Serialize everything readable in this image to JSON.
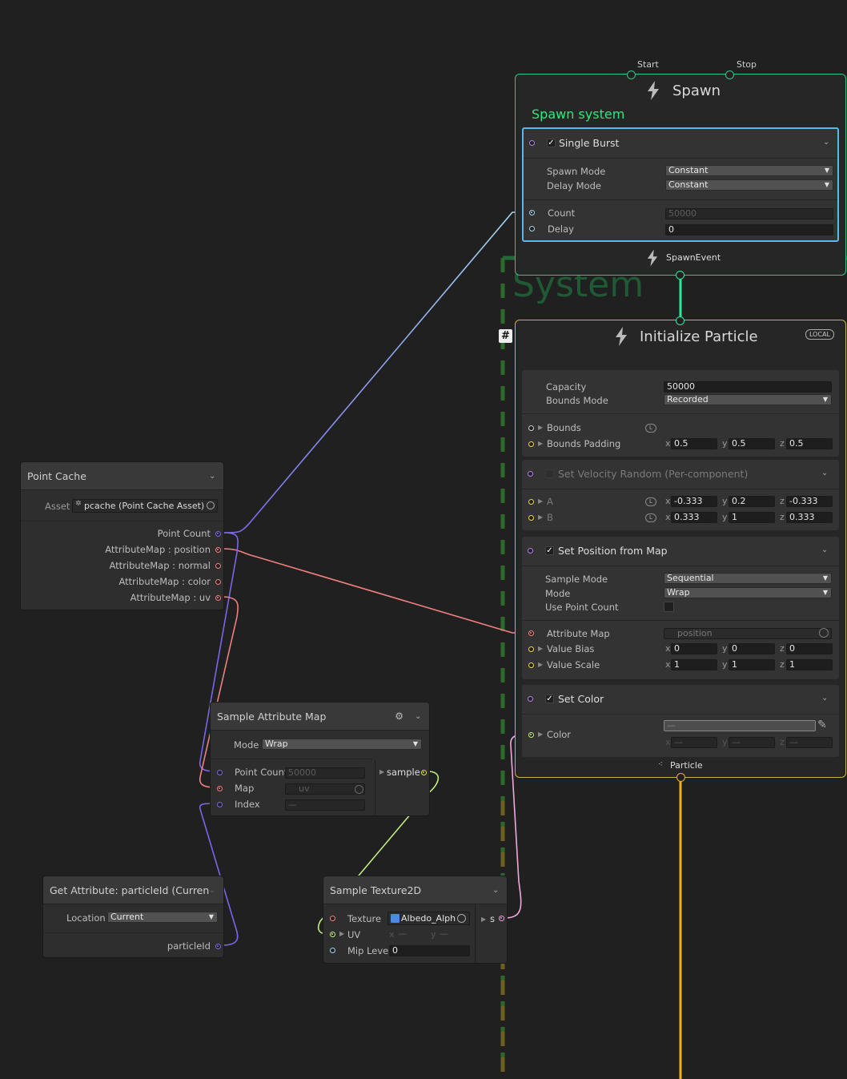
{
  "colors": {
    "background": "#202020",
    "spawn_context": "#2fc68a",
    "init_context": "#c9b340",
    "system_dashes_green": "#1f6a38",
    "system_dashes_yellow": "#7a6a1a",
    "selection_blue": "#5ab8f0",
    "wire_uint": "#7a66e8",
    "wire_vector3": "#f08080",
    "wire_vector2": "#c0f080",
    "wire_color": "#f0a8d8",
    "wire_float": "#a0d8f0",
    "flow_spawn": "#2ee89a",
    "flow_particle": "#f0b020"
  },
  "system": {
    "label": "System"
  },
  "spawn": {
    "start_label": "Start",
    "stop_label": "Stop",
    "icon": "lightning-icon",
    "title": "Spawn",
    "subtitle": "Spawn system",
    "output_label": "SpawnEvent",
    "burst": {
      "title": "Single Burst",
      "checked": true,
      "spawn_mode_label": "Spawn Mode",
      "spawn_mode_value": "Constant",
      "delay_mode_label": "Delay Mode",
      "delay_mode_value": "Constant",
      "count_label": "Count",
      "count_value": "50000",
      "delay_label": "Delay",
      "delay_value": "0"
    }
  },
  "init": {
    "title": "Initialize Particle",
    "badge": "LOCAL",
    "hash": "#",
    "capacity_label": "Capacity",
    "capacity_value": "50000",
    "bounds_mode_label": "Bounds Mode",
    "bounds_mode_value": "Recorded",
    "bounds_label": "Bounds",
    "bounds_padding_label": "Bounds Padding",
    "bounds_padding": {
      "x": "0.5",
      "y": "0.5",
      "z": "0.5"
    },
    "velocity": {
      "title": "Set Velocity Random (Per-component)",
      "checked": false,
      "a_label": "A",
      "a": {
        "x": "-0.333",
        "y": "0.2",
        "z": "-0.333"
      },
      "b_label": "B",
      "b": {
        "x": "0.333",
        "y": "1",
        "z": "0.333"
      }
    },
    "position_map": {
      "title": "Set Position from Map",
      "checked": true,
      "sample_mode_label": "Sample Mode",
      "sample_mode_value": "Sequential",
      "mode_label": "Mode",
      "mode_value": "Wrap",
      "use_point_count_label": "Use Point Count",
      "attribute_map_label": "Attribute Map",
      "attribute_map_value": "position",
      "value_bias_label": "Value Bias",
      "value_bias": {
        "x": "0",
        "y": "0",
        "z": "0"
      },
      "value_scale_label": "Value Scale",
      "value_scale": {
        "x": "1",
        "y": "1",
        "z": "1"
      }
    },
    "color": {
      "title": "Set Color",
      "checked": true,
      "color_label": "Color",
      "dash": "—"
    },
    "output_label": "Particle"
  },
  "point_cache": {
    "title": "Point Cache",
    "asset_label": "Asset",
    "asset_value": "pcache (Point Cache Asset)",
    "outputs": [
      "Point Count",
      "AttributeMap : position",
      "AttributeMap : normal",
      "AttributeMap : color",
      "AttributeMap : uv"
    ]
  },
  "sample_attr": {
    "title": "Sample Attribute Map",
    "mode_label": "Mode",
    "mode_value": "Wrap",
    "point_count_label": "Point Count",
    "point_count_value": "50000",
    "map_label": "Map",
    "map_value": "uv",
    "index_label": "Index",
    "index_value": "—",
    "output_label": "sample"
  },
  "get_attr": {
    "title": "Get Attribute: particleId (Current)",
    "location_label": "Location",
    "location_value": "Current",
    "output_label": "particleId"
  },
  "sample_tex": {
    "title": "Sample Texture2D",
    "texture_label": "Texture",
    "texture_value": "Albedo_Alph",
    "uv_label": "UV",
    "mip_label": "Mip Level",
    "mip_value": "0",
    "output_label": "s",
    "dash": "—"
  },
  "axes": {
    "x": "x",
    "y": "y",
    "z": "z"
  }
}
